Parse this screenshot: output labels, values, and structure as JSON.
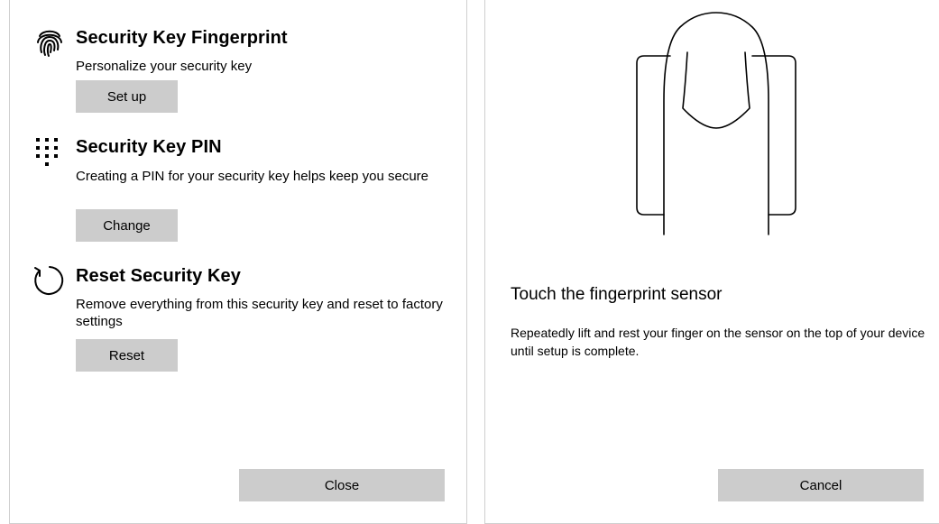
{
  "left": {
    "fingerprint": {
      "title": "Security Key Fingerprint",
      "description": "Personalize your security key",
      "button": "Set up"
    },
    "pin": {
      "title": "Security Key PIN",
      "description": "Creating a PIN for your security key helps keep you secure",
      "button": "Change"
    },
    "reset": {
      "title": "Reset Security Key",
      "description": "Remove everything from this security key and reset to factory settings",
      "button": "Reset"
    },
    "close_label": "Close"
  },
  "right": {
    "title": "Touch the fingerprint sensor",
    "description": "Repeatedly lift and rest your finger on the sensor on the top of your device until setup is complete.",
    "cancel_label": "Cancel"
  },
  "icons": {
    "fingerprint": "fingerprint-icon",
    "pin": "keypad-icon",
    "reset": "reset-icon",
    "illustration": "finger-on-key-illustration"
  },
  "colors": {
    "button_bg": "#cccccc",
    "border": "#cfcfcf"
  }
}
